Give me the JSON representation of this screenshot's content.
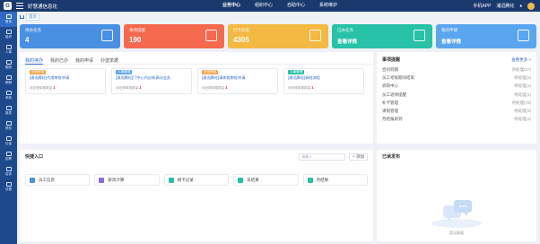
{
  "app": {
    "title": "好慧通信息化",
    "logo_text": "G"
  },
  "topnav": [
    "业务中心",
    "组织中心",
    "自助中心",
    "系统维护"
  ],
  "topbar": {
    "mobile_app": "手机APP",
    "user_name": "浦迅腾化",
    "bell": "bell-icon"
  },
  "sidebar": [
    {
      "label": "首页"
    },
    {
      "label": "组织"
    },
    {
      "label": "人事"
    },
    {
      "label": "假勤"
    },
    {
      "label": "薪酬"
    },
    {
      "label": "考勤"
    },
    {
      "label": "报表"
    },
    {
      "label": "绩效"
    },
    {
      "label": "社保"
    },
    {
      "label": "招聘"
    },
    {
      "label": "培训"
    },
    {
      "label": "设置"
    }
  ],
  "breadcrumb": {
    "home": "首页"
  },
  "stats": [
    {
      "label": "待办任务",
      "value": "4",
      "color": "#4a90e2"
    },
    {
      "label": "事项提醒",
      "value": "190",
      "color": "#f5694f"
    },
    {
      "label": "打卡异常",
      "value": "4305",
      "color": "#f4b942"
    },
    {
      "label": "已办任务",
      "value": "查看详情",
      "color": "#27c2a8"
    },
    {
      "label": "我的申请",
      "value": "查看详情",
      "color": "#5aa6ee"
    }
  ],
  "tasks": {
    "tabs": [
      "我的待办",
      "我的已办",
      "我的申请",
      "抄送单据"
    ],
    "items": [
      {
        "tag": "待我审批",
        "tag_color": "#f4a34a",
        "title": "[浦迅腾化]代理审批申请",
        "meta": "待处理单据数量:",
        "count": "1"
      },
      {
        "tag": "人事管理",
        "tag_color": "#5aa6ee",
        "title": "[浦迅腾化]门中心内自有调动业务",
        "meta": "待处理单据数量:",
        "count": "1"
      },
      {
        "tag": "待我审批",
        "tag_color": "#f4a34a",
        "title": "[浦迅腾化]请休假审批申请",
        "meta": "待处理单据数量:",
        "count": "1"
      },
      {
        "tag": "人事管理",
        "tag_color": "#27c2a8",
        "title": "[浦迅腾化]调档流程",
        "meta": "待处理单据数量:",
        "count": "1"
      }
    ]
  },
  "matters": {
    "title": "事项提醒",
    "more": "查看更多 >",
    "rows": [
      {
        "label": "合同到期",
        "count": "待处理(27)"
      },
      {
        "label": "员工考核期间结束",
        "count": "待处理(1)"
      },
      {
        "label": "调岗中心",
        "count": "待处理(1)"
      },
      {
        "label": "员工退休提醒",
        "count": "待处理(1)"
      },
      {
        "label": "补卡管理",
        "count": "待处理(73)"
      },
      {
        "label": "请假管理",
        "count": "待处理(3)"
      },
      {
        "label": "月结报表到",
        "count": "待处理(2)"
      }
    ]
  },
  "quick": {
    "title": "快捷入口",
    "search_placeholder": "请输入",
    "add_label": "+ 添加",
    "items": [
      {
        "label": "员工信息",
        "color": "#4a90e2"
      },
      {
        "label": "薪资计算",
        "color": "#8b6ae0"
      },
      {
        "label": "刷卡记录",
        "color": "#27c2a8"
      },
      {
        "label": "日结果",
        "color": "#27c2a8"
      },
      {
        "label": "月结果",
        "color": "#27c2a8"
      }
    ]
  },
  "notice": {
    "title": "已读发布",
    "empty": "暂无数据"
  }
}
